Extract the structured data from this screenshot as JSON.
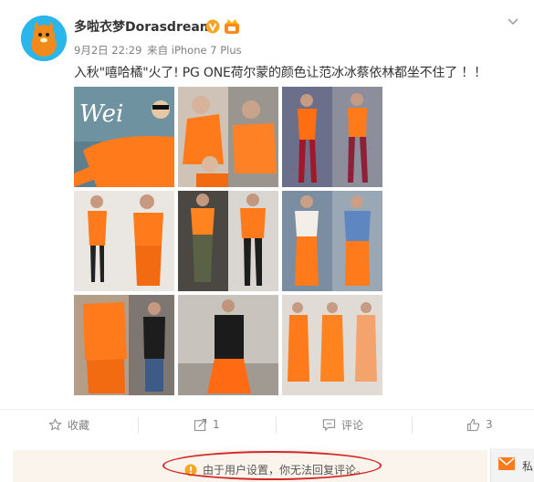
{
  "post": {
    "username": "多啦衣梦Dorasdream",
    "date": "9月2日 22:29",
    "source_prefix": "来自",
    "device": "iPhone 7 Plus",
    "text": "入秋\"嘻哈橘\"火了! PG ONE荷尔蒙的颜色让范冰冰蔡依林都坐不住了 ！！"
  },
  "images": {
    "img1_overlay": "Wei"
  },
  "actions": {
    "favorite": "收藏",
    "share": "1",
    "comment": "评论",
    "like": "3"
  },
  "notice": {
    "text": "由于用户设置，你无法回复评论。"
  },
  "side_tab": {
    "label": "私"
  },
  "colors": {
    "accent_orange": "#ff7a1a",
    "avatar_blue": "#2ab6ea",
    "highlight_red": "#d42828",
    "notice_bg": "#fbf4ec",
    "verified_gold": "#f6a623"
  }
}
